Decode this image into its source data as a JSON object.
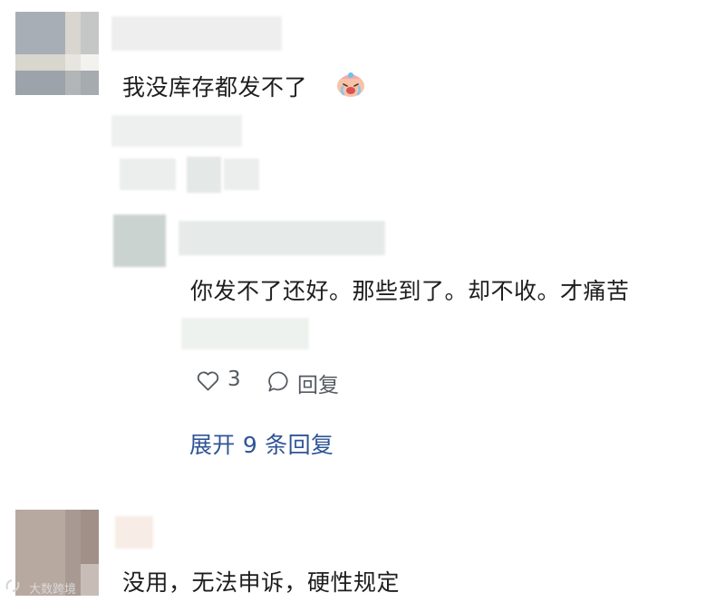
{
  "comments": [
    {
      "text": "我没库存都发不了",
      "emoji": "crying-face-emoji"
    },
    {
      "text": "你发不了还好。那些到了。却不收。才痛苦",
      "like_icon": "heart-outline-icon",
      "like_count": "3",
      "reply_icon": "speech-bubble-icon",
      "reply_label": "回复"
    },
    {
      "text": "没用，无法申诉，硬性规定"
    }
  ],
  "expand_replies": "展开 9 条回复",
  "watermark": "大数跨境",
  "colors": {
    "link": "#2f5597",
    "text": "#1e1e1e",
    "action": "#555a61"
  }
}
